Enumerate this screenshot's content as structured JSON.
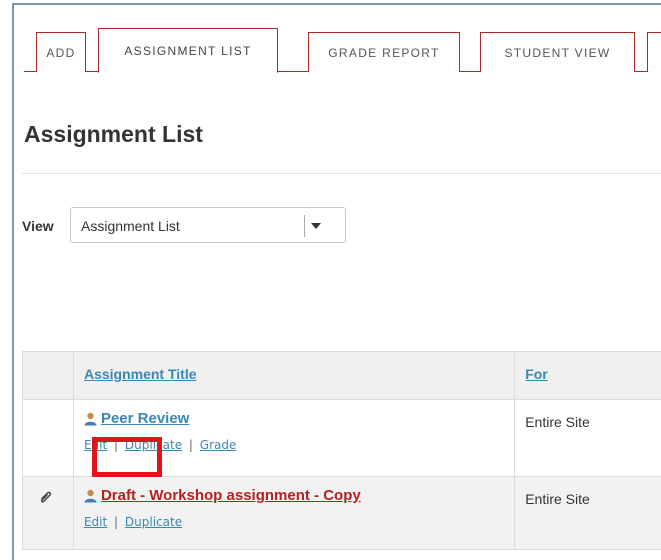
{
  "tabs": [
    {
      "label": "ADD"
    },
    {
      "label": "ASSIGNMENT LIST"
    },
    {
      "label": "GRADE REPORT"
    },
    {
      "label": "STUDENT VIEW"
    }
  ],
  "page_title": "Assignment List",
  "view": {
    "label": "View",
    "selected": "Assignment List"
  },
  "table": {
    "headers": {
      "title": "Assignment Title",
      "for": "For"
    },
    "rows": [
      {
        "title": "Peer Review",
        "title_color": "#3b87b3",
        "for": "Entire Site",
        "actions": {
          "edit": "Edit",
          "duplicate": "Duplicate",
          "grade": "Grade"
        }
      },
      {
        "title": "Draft - Workshop assignment - Copy",
        "title_color": "#b81f1f",
        "for": "Entire Site",
        "actions": {
          "edit": "Edit",
          "duplicate": "Duplicate"
        }
      }
    ]
  },
  "colors": {
    "tab_border": "#a52a2a",
    "link": "#3b87b3",
    "draft": "#b81f1f",
    "highlight": "#e0141c"
  }
}
